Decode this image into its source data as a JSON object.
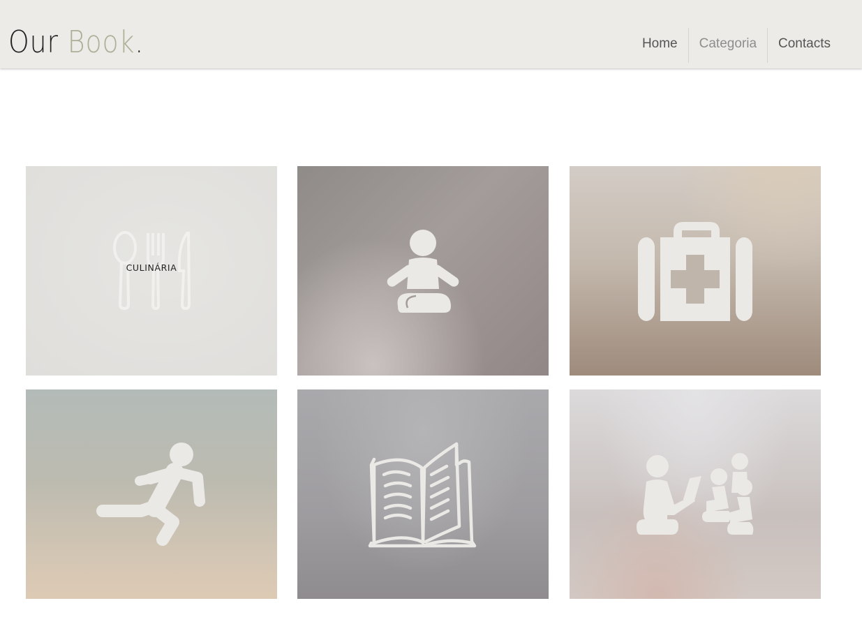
{
  "header": {
    "logo_part1": "Our",
    "logo_part2": "Book",
    "logo_dot": "."
  },
  "nav": {
    "items": [
      {
        "label": "Home"
      },
      {
        "label": "Categoria"
      },
      {
        "label": "Contacts"
      }
    ]
  },
  "categories": [
    {
      "icon": "utensils-icon",
      "label": "CULINÁRIA"
    },
    {
      "icon": "meditation-icon"
    },
    {
      "icon": "first-aid-kit-icon"
    },
    {
      "icon": "running-person-icon"
    },
    {
      "icon": "open-book-icon"
    },
    {
      "icon": "teacher-children-icon"
    }
  ],
  "colors": {
    "header_bg": "#ecebe8",
    "logo_accent": "#aeaf97",
    "icon_fill": "#ebe9e6"
  }
}
